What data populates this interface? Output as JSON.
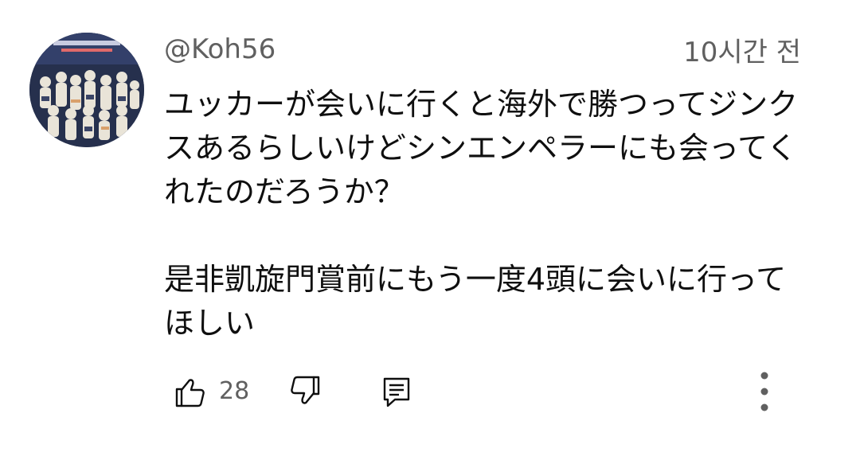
{
  "comment": {
    "author": "@Koh56",
    "timestamp": "10시간 전",
    "text": "ユッカーが会いに行くと海外で勝つってジンクスあるらしいけどシンエンペラーにも会ってくれたのだろうか？\n\n是非凱旋門賞前にもう一度4頭に会いに行ってほしい",
    "avatar": "avatar-image",
    "accent": "#606060"
  },
  "actions": {
    "like_icon": "thumbs-up-icon",
    "like_count": "28",
    "dislike_icon": "thumbs-down-icon",
    "reply_icon": "reply-comment-icon",
    "more_icon": "vertical-ellipsis-icon"
  }
}
